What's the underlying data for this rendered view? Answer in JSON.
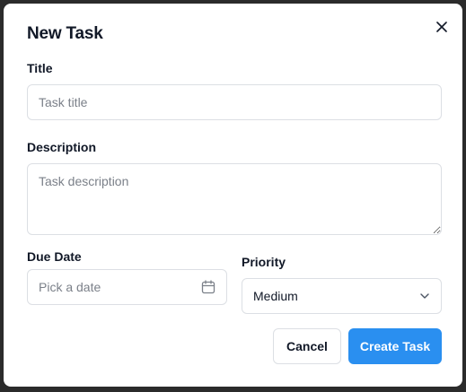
{
  "dialog": {
    "title": "New Task",
    "close_icon": "close-icon"
  },
  "form": {
    "title_label": "Title",
    "title_placeholder": "Task title",
    "title_value": "",
    "description_label": "Description",
    "description_placeholder": "Task description",
    "description_value": "",
    "due_date_label": "Due Date",
    "due_date_placeholder": "Pick a date",
    "due_date_icon": "calendar-icon",
    "priority_label": "Priority",
    "priority_selected": "Medium",
    "priority_icon": "chevron-down-icon"
  },
  "actions": {
    "cancel_label": "Cancel",
    "create_label": "Create Task"
  },
  "colors": {
    "primary": "#2a8ff0",
    "border": "#dcdfe4",
    "text": "#111827",
    "placeholder": "#7b8089",
    "backdrop": "#2b2b2b"
  }
}
